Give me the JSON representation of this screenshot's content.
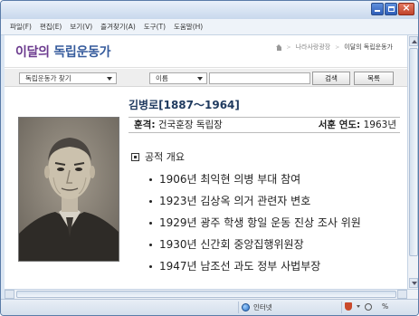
{
  "menubar": {
    "items": [
      "파일(F)",
      "편집(E)",
      "보기(V)",
      "즐겨찾기(A)",
      "도구(T)",
      "도움말(H)"
    ]
  },
  "header": {
    "title_part1": "이달의",
    "title_part2": " 독립운동가",
    "breadcrumb": {
      "separator": ">",
      "items": [
        "나라사랑광장",
        "이달의 독립운동가"
      ]
    }
  },
  "search": {
    "category_select": "독립운동가 찾기",
    "field_select": "이름",
    "query": "",
    "search_button": "검색",
    "list_button": "목록"
  },
  "profile": {
    "name": "김병로[1887～1964]",
    "award_label": "훈격:",
    "award_value": " 건국훈장 독립장",
    "year_label": "서훈 연도:",
    "year_value": " 1963년"
  },
  "merits": {
    "section_title": "공적 개요",
    "items": [
      "1906년 최익현 의병 부대 참여",
      "1923년 김상옥 의거 관련자 변호",
      "1929년 광주 학생 항일 운동 진상 조사 위원",
      "1930년 신간회 중앙집행위원장",
      "1947년 남조선 과도 정부 사법부장"
    ]
  },
  "statusbar": {
    "zone": "인터넷",
    "zoom": "%"
  },
  "colors": {
    "title_purple": "#6b3a8e",
    "title_blue": "#355b9c",
    "name_navy": "#1f3a5f"
  }
}
